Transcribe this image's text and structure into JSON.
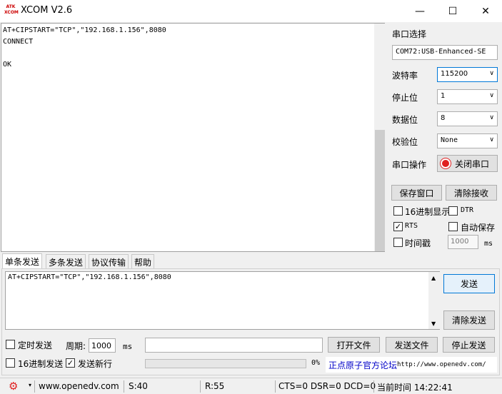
{
  "window": {
    "icon_text_top": "ATK",
    "icon_text_bottom": "XCOM",
    "title": "XCOM V2.6",
    "minimize": "—",
    "maximize": "☐",
    "close": "✕"
  },
  "receive": {
    "text": "AT+CIPSTART=\"TCP\",\"192.168.1.156\",8080\nCONNECT\n\nOK"
  },
  "port": {
    "section_label": "串口选择",
    "port_value": "COM72:USB-Enhanced-SE",
    "baud_label": "波特率",
    "baud_value": "115200",
    "stop_label": "停止位",
    "stop_value": "1",
    "data_label": "数据位",
    "data_value": "8",
    "parity_label": "校验位",
    "parity_value": "None",
    "op_label": "串口操作",
    "op_button": "关闭串口"
  },
  "receive_controls": {
    "save_window": "保存窗口",
    "clear_receive": "清除接收",
    "hex_display": "16进制显示",
    "dtr": "DTR",
    "rts": "RTS",
    "auto_save": "自动保存",
    "timestamp": "时间戳",
    "timestamp_value": "1000",
    "timestamp_unit": "ms"
  },
  "tabs": [
    "单条发送",
    "多条发送",
    "协议传输",
    "帮助"
  ],
  "send": {
    "text": "AT+CIPSTART=\"TCP\",\"192.168.1.156\",8080",
    "send_button": "发送",
    "clear_send": "清除发送",
    "timed_send": "定时发送",
    "period_label": "周期:",
    "period_value": "1000",
    "period_unit": "ms",
    "open_file": "打开文件",
    "send_file": "发送文件",
    "stop_send": "停止发送",
    "hex_send": "16进制发送",
    "send_newline": "发送新行",
    "progress_text": "0%",
    "progress_fraction": 0,
    "forum_text": "正点原子官方论坛",
    "forum_url": "http://www.openedv.com/"
  },
  "status": {
    "site": "www.openedv.com",
    "sent": "S:40",
    "received": "R:55",
    "lines": "CTS=0 DSR=0 DCD=0",
    "time": "当前时间 14:22:41"
  },
  "colors": {
    "accent_red": "#e02020",
    "focus_blue": "#0078d7"
  }
}
